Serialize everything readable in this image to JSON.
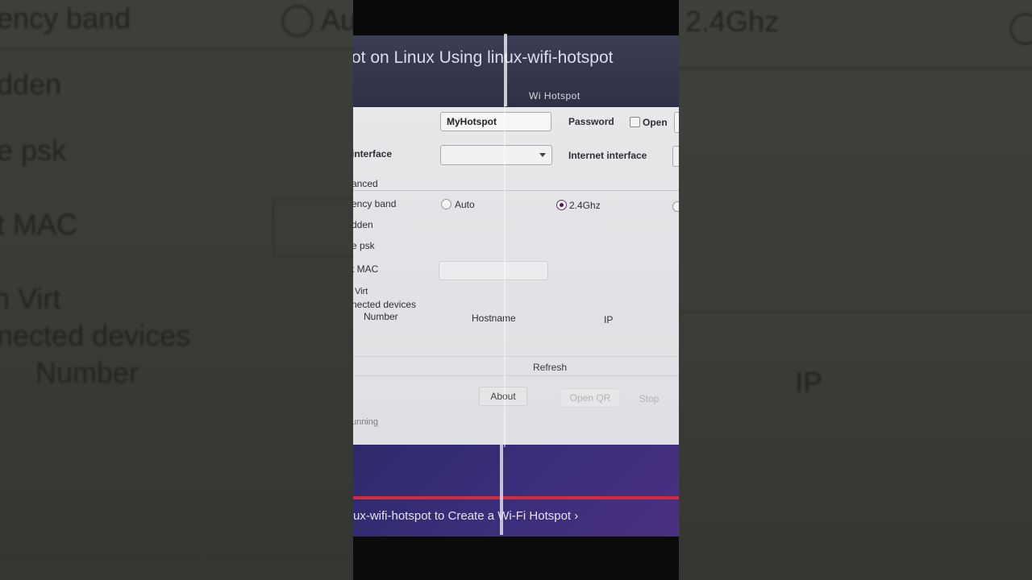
{
  "background_left": {
    "row1": "ency band",
    "row2": "dden",
    "row3": "e psk",
    "row4": "t MAC",
    "row5": "n Virt",
    "row6": "nected devices",
    "row7": "Number",
    "radio_auto_partial": "Au"
  },
  "background_right": {
    "band_24": "2.4Ghz",
    "ip_header": "IP"
  },
  "article": {
    "title": "ot on Linux Using linux-wifi-hotspot",
    "bottom_link": "ux-wifi-hotspot to Create a Wi-Fi Hotspot ›"
  },
  "window": {
    "title": "Wi Hotspot",
    "ssid_value": "MyHotspot",
    "password_label": "Password",
    "open_label": "Open",
    "wifi_interface_label": "interface",
    "internet_interface_label": "Internet interface",
    "advanced_label": "anced",
    "freq_band_label": "ency band",
    "band_options": [
      "Auto",
      "2.4Ghz"
    ],
    "selected_band": "2.4Ghz",
    "hidden_label": "dden",
    "psk_label": "e psk",
    "mac_label": "t MAC",
    "virt_label": "Virt",
    "connected_devices_label": "nected devices",
    "table_headers": [
      "Number",
      "Hostname",
      "IP"
    ],
    "refresh_label": "Refresh",
    "about_label": "About",
    "open_qr_label": "Open QR",
    "stop_label": "Stop",
    "status_text": "unning"
  },
  "colors": {
    "accent_purple": "#4a1a55",
    "title_bar": "#2e3045",
    "red_bar": "#d62a3a"
  }
}
